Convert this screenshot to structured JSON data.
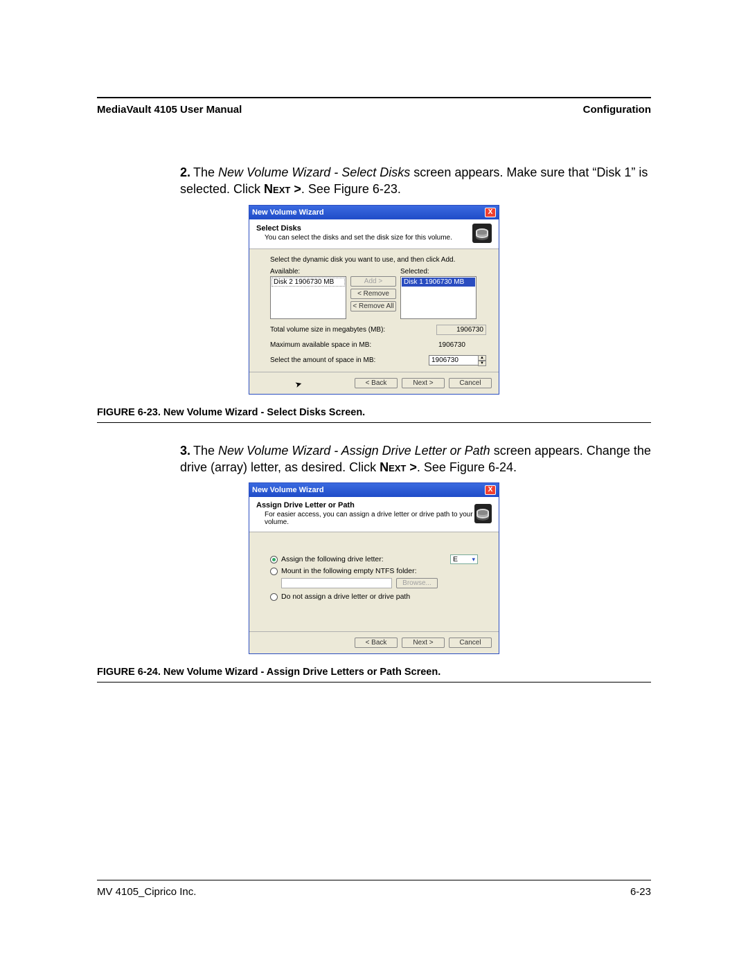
{
  "header": {
    "left": "MediaVault 4105 User Manual",
    "right": "Configuration"
  },
  "step2": {
    "num": "2.",
    "text_a": "The ",
    "italic": "New Volume Wizard - Select Disks",
    "text_b": " screen appears. Make sure that “Disk 1” is selected. Click ",
    "next": "Next >",
    "text_c": ". See Figure 6-23."
  },
  "wiz1": {
    "title": "New Volume Wizard",
    "head_title": "Select Disks",
    "head_sub": "You can select the disks and set the disk size for this volume.",
    "instr": "Select the dynamic disk you want to use, and then click Add.",
    "avail_label": "Available:",
    "sel_label": "Selected:",
    "avail_item": "Disk 2    1906730 MB",
    "sel_item": "Disk 1    1906730 MB",
    "add": "Add >",
    "remove": "< Remove",
    "removeall": "< Remove All",
    "total_label": "Total volume size in megabytes (MB):",
    "total_val": "1906730",
    "max_label": "Maximum available space in MB:",
    "max_val": "1906730",
    "amt_label": "Select the amount of space in MB:",
    "amt_val": "1906730",
    "back": "< Back",
    "next": "Next >",
    "cancel": "Cancel"
  },
  "fig1": "FIGURE 6-23. New Volume Wizard - Select Disks Screen.",
  "step3": {
    "num": "3.",
    "text_a": "The ",
    "italic": "New Volume Wizard - Assign Drive Letter or Path",
    "text_b": " screen appears. Change the drive (array) letter, as desired. Click ",
    "next": "Next >",
    "text_c": ". See Figure 6-24."
  },
  "wiz2": {
    "title": "New Volume Wizard",
    "head_title": "Assign Drive Letter or Path",
    "head_sub": "For easier access, you can assign a drive letter or drive path to your volume.",
    "opt1": "Assign the following drive letter:",
    "letter": "E",
    "opt2": "Mount in the following empty NTFS folder:",
    "browse": "Browse...",
    "opt3": "Do not assign a drive letter or drive path",
    "back": "< Back",
    "next": "Next >",
    "cancel": "Cancel"
  },
  "fig2": "FIGURE 6-24. New Volume Wizard - Assign Drive Letters or Path Screen.",
  "footer": {
    "left": "MV 4105_Ciprico Inc.",
    "right": "6-23"
  }
}
